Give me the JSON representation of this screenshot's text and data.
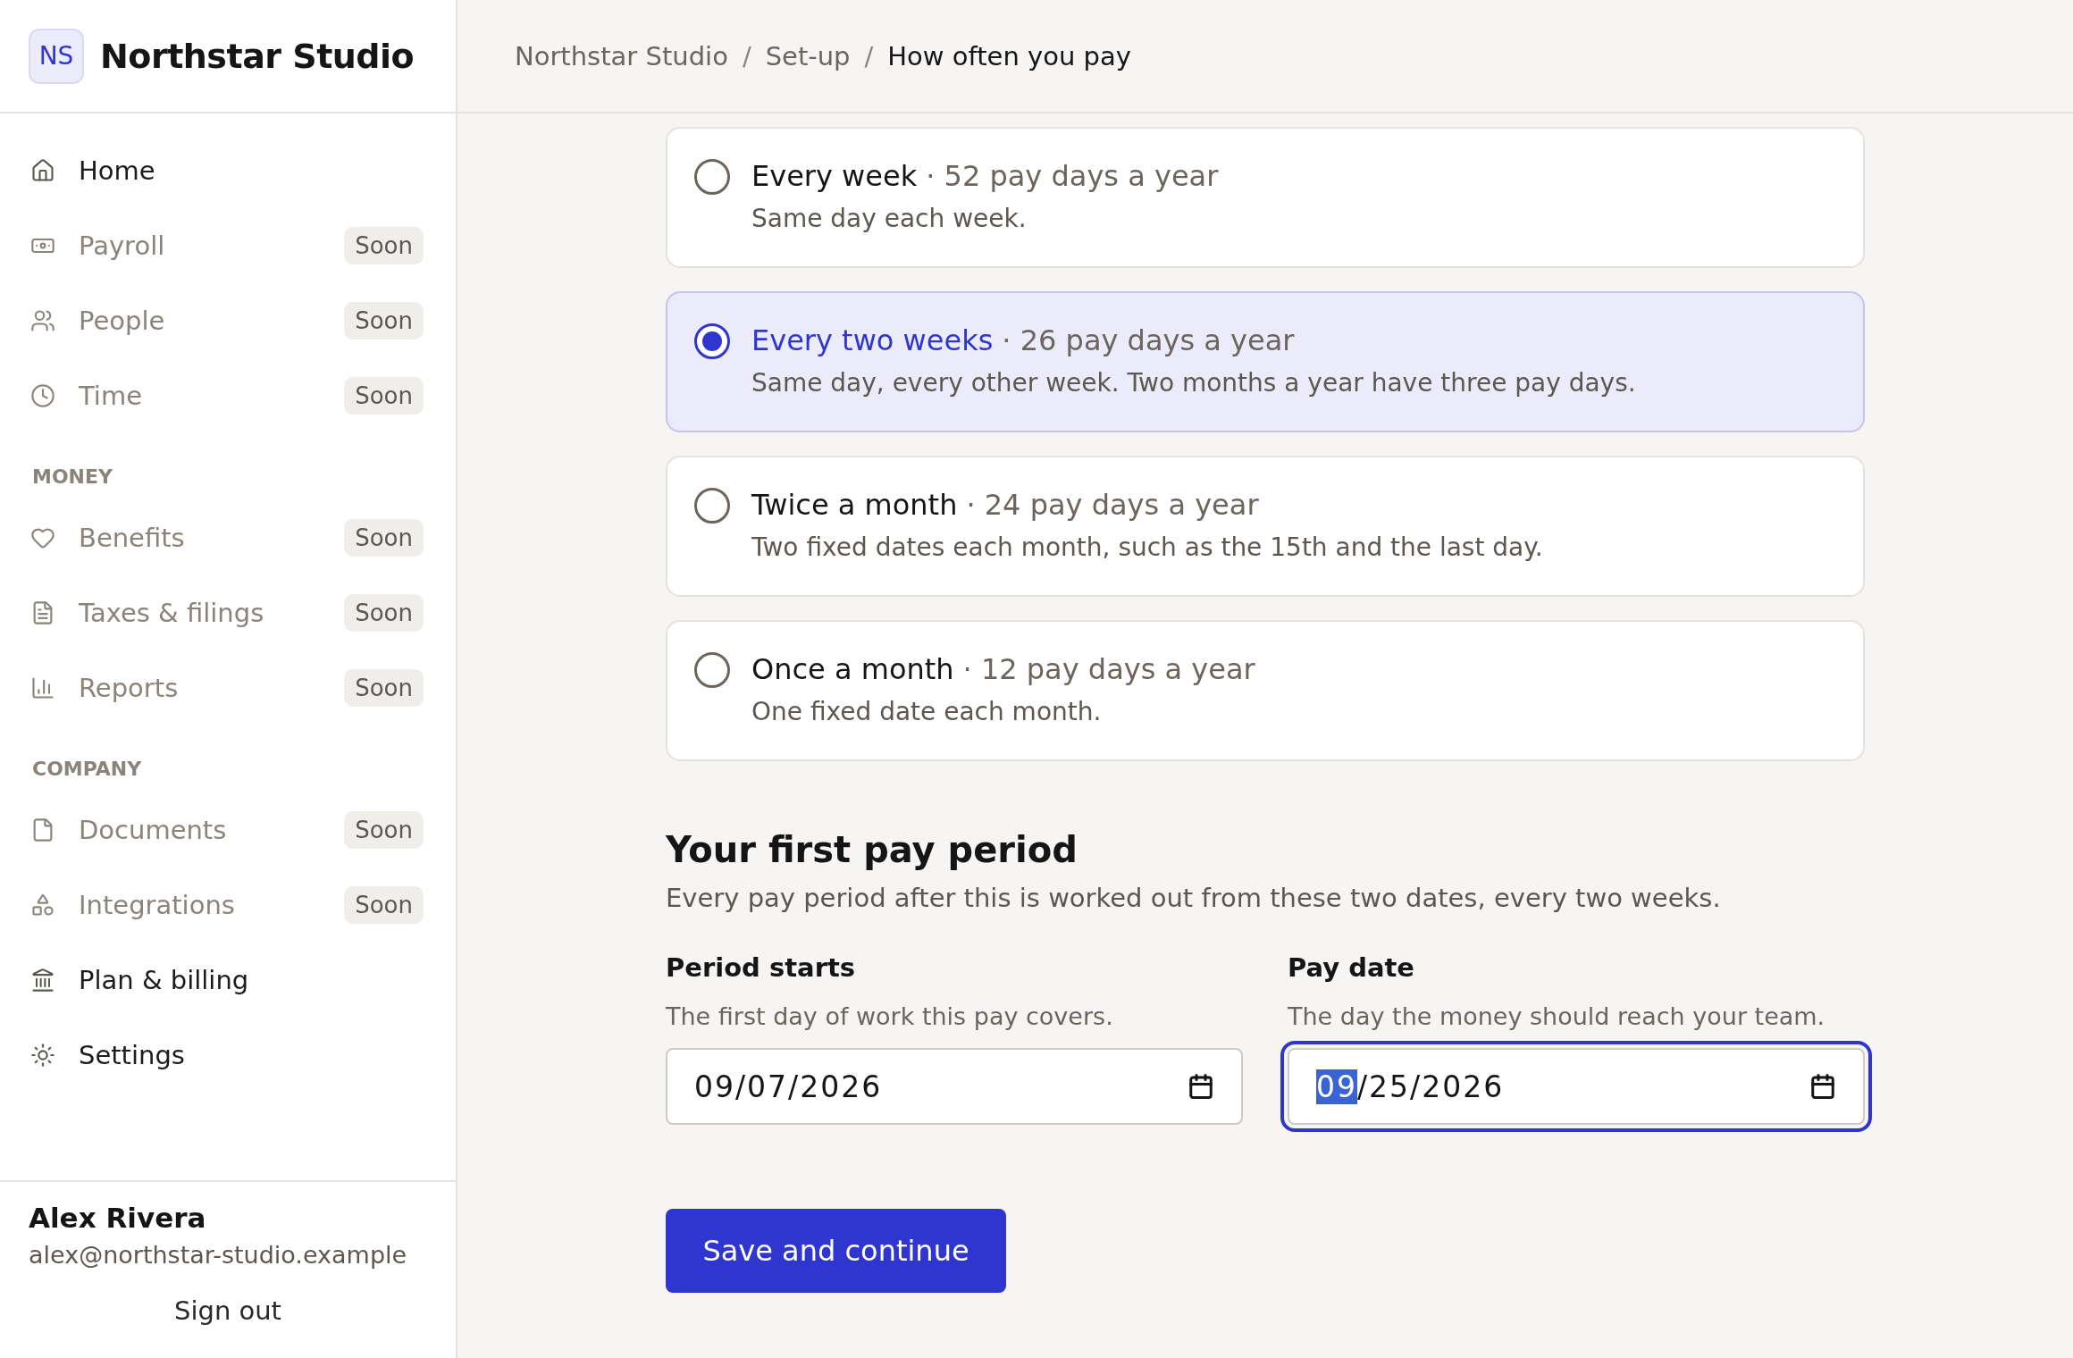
{
  "brand": {
    "initials": "NS",
    "name": "Northstar Studio"
  },
  "nav": [
    {
      "items": [
        {
          "label": "Home",
          "disabled": false
        },
        {
          "label": "Payroll",
          "disabled": true,
          "badge": "Soon"
        },
        {
          "label": "People",
          "disabled": true,
          "badge": "Soon"
        },
        {
          "label": "Time",
          "disabled": true,
          "badge": "Soon"
        }
      ]
    },
    {
      "heading": "MONEY",
      "items": [
        {
          "label": "Benefits",
          "disabled": true,
          "badge": "Soon"
        },
        {
          "label": "Taxes & filings",
          "disabled": true,
          "badge": "Soon"
        },
        {
          "label": "Reports",
          "disabled": true,
          "badge": "Soon"
        }
      ]
    },
    {
      "heading": "COMPANY",
      "items": [
        {
          "label": "Documents",
          "disabled": true,
          "badge": "Soon"
        },
        {
          "label": "Integrations",
          "disabled": true,
          "badge": "Soon"
        },
        {
          "label": "Plan & billing",
          "disabled": false
        },
        {
          "label": "Settings",
          "disabled": false
        }
      ]
    }
  ],
  "user": {
    "name": "Alex Rivera",
    "email": "alex@northstar-studio.example",
    "sign_out": "Sign out"
  },
  "breadcrumb": [
    {
      "label": "Northstar Studio",
      "current": false
    },
    {
      "label": "Set-up",
      "current": false
    },
    {
      "label": "How often you pay",
      "current": true
    }
  ],
  "breadcrumb_separator": "/",
  "options": [
    {
      "title": "Every week",
      "meta": "· 52 pay days a year",
      "description": "Same day each week.",
      "selected": false
    },
    {
      "title": "Every two weeks",
      "meta": "· 26 pay days a year",
      "description": "Same day, every other week. Two months a year have three pay days.",
      "selected": true
    },
    {
      "title": "Twice a month",
      "meta": "· 24 pay days a year",
      "description": "Two fixed dates each month, such as the 15th and the last day.",
      "selected": false
    },
    {
      "title": "Once a month",
      "meta": "· 12 pay days a year",
      "description": "One fixed date each month.",
      "selected": false
    }
  ],
  "period": {
    "title": "Your first pay period",
    "description": "Every pay period after this is worked out from these two dates, every two weeks.",
    "fields": [
      {
        "label": "Period starts",
        "hint": "The first day of work this pay covers.",
        "value": "09/07/2026",
        "focused": false
      },
      {
        "label": "Pay date",
        "hint": "The day the money should reach your team.",
        "value": "09/25/2026",
        "focused": true
      }
    ]
  },
  "submit": "Save and continue"
}
